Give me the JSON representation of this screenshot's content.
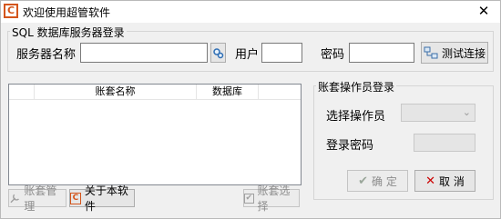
{
  "window": {
    "title": "欢迎使用超管软件",
    "app_icon": "C",
    "close_glyph": "✕"
  },
  "sql_group": {
    "legend": "SQL 数据库服务器登录",
    "server_label": "服务器名称",
    "server_value": "",
    "user_label": "用户",
    "user_value": "",
    "password_label": "密码",
    "password_value": "",
    "test_button": "测试连接"
  },
  "account_table": {
    "columns": [
      "",
      "账套名称",
      "数据库"
    ],
    "rows": []
  },
  "operator_group": {
    "legend": "账套操作员登录",
    "operator_label": "选择操作员",
    "operator_value": "",
    "password_label": "登录密码",
    "password_value": ""
  },
  "buttons": {
    "confirm": "确 定",
    "cancel": "取 消",
    "account_manage": "账套管理",
    "about": "关于本软件",
    "account_select": "账套选择"
  },
  "colors": {
    "brand": "#d4551b",
    "cancel_x": "#cc0000",
    "confirm_check": "#9aa69a"
  }
}
